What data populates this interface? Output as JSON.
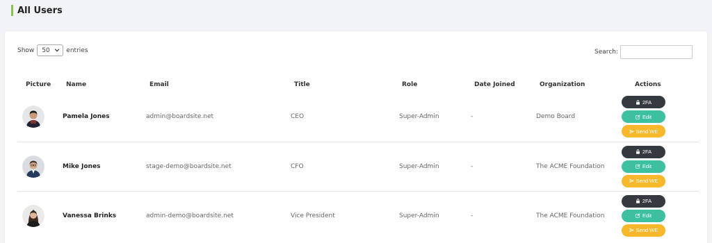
{
  "page": {
    "title": "All Users"
  },
  "controls": {
    "show_label": "Show",
    "entries_value": "50",
    "entries_label": "entries",
    "search_label": "Search:",
    "search_value": ""
  },
  "table": {
    "headers": {
      "picture": "Picture",
      "name": "Name",
      "email": "Email",
      "title": "Title",
      "role": "Role",
      "date_joined": "Date Joined",
      "organization": "Organization",
      "actions": "Actions"
    },
    "rows": [
      {
        "name": "Pamela Jones",
        "email": "admin@boardsite.net",
        "title": "CEO",
        "role": "Super-Admin",
        "date_joined": "-",
        "organization": "Demo Board"
      },
      {
        "name": "Mike Jones",
        "email": "stage-demo@boardsite.net",
        "title": "CFO",
        "role": "Super-Admin",
        "date_joined": "-",
        "organization": "The ACME Foundation"
      },
      {
        "name": "Vanessa Brinks",
        "email": "admin-demo@boardsite.net",
        "title": "Vice President",
        "role": "Super-Admin",
        "date_joined": "-",
        "organization": "The ACME Foundation"
      }
    ],
    "actions": {
      "twofa": "2FA",
      "edit": "Edit",
      "send": "Send WE"
    }
  },
  "icons": {
    "twofa": "lock-icon",
    "edit": "edit-icon",
    "send": "send-icon",
    "select": "chevron-down-icon"
  },
  "colors": {
    "accent": "#8bc34a",
    "twofa_btn": "#343a40",
    "edit_btn": "#3cc0a0",
    "send_btn": "#f9b82c"
  }
}
